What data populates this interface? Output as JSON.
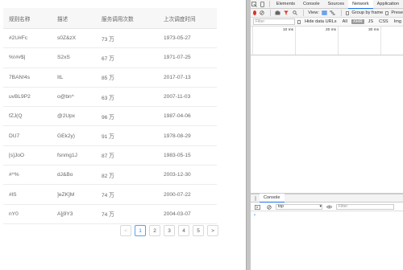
{
  "table": {
    "headers": [
      "规则名称",
      "描述",
      "服务调用次数",
      "上次调度时间"
    ],
    "rows": [
      [
        "#2U#Fc",
        "s0Z&zX",
        "73 万",
        "1973-05-27"
      ],
      [
        "%!##$|",
        "S2xS",
        "67 万",
        "1971-07-25"
      ],
      [
        "7BAN!4s",
        "ItL",
        "85 万",
        "2017-07-13"
      ],
      [
        "uvBL9P2",
        "o@bn^",
        "63 万",
        "2007-11-03"
      ],
      [
        "fZJ(Q",
        "@2Upx",
        "96 万",
        "1987-04-06"
      ],
      [
        "DU7",
        "GEk2y)",
        "91 万",
        "1978-08-29"
      ],
      [
        "[s]JoO",
        "fsnmg1J",
        "87 万",
        "1983-05-15"
      ],
      [
        "#^%",
        "dJ&Bo",
        "82 万",
        "2003-12-30"
      ],
      [
        "#lS",
        "]eZK]M",
        "74 万",
        "2000-07-22"
      ],
      [
        "nY0",
        "A]j9Y3",
        "74 万",
        "2004-03-07"
      ]
    ]
  },
  "pagination": {
    "prev": "<",
    "pages": [
      "1",
      "2",
      "3",
      "4",
      "5"
    ],
    "current": "1",
    "next": ">"
  },
  "devtools": {
    "tabs": [
      "Elements",
      "Console",
      "Sources",
      "Network",
      "Application"
    ],
    "active_tab": "Network",
    "network_toolbar": {
      "view_label": "View:",
      "group_by_frame": "Group by frame",
      "preserve_log": "Prese"
    },
    "filter_placeholder": "Filter",
    "hide_data_urls": "Hide data URLs",
    "types": [
      "All",
      "XHR",
      "JS",
      "CSS",
      "Img"
    ],
    "active_type": "XHR",
    "timeline_ticks": [
      "10 ms",
      "20 ms",
      "30 ms"
    ],
    "drawer_tab": "Console",
    "context": "top",
    "console_filter_placeholder": "Filter",
    "prompt": "›"
  },
  "colors": {
    "accent": "#3a87e0",
    "record": "#d93025",
    "devtools_active": "#1a73e8"
  }
}
